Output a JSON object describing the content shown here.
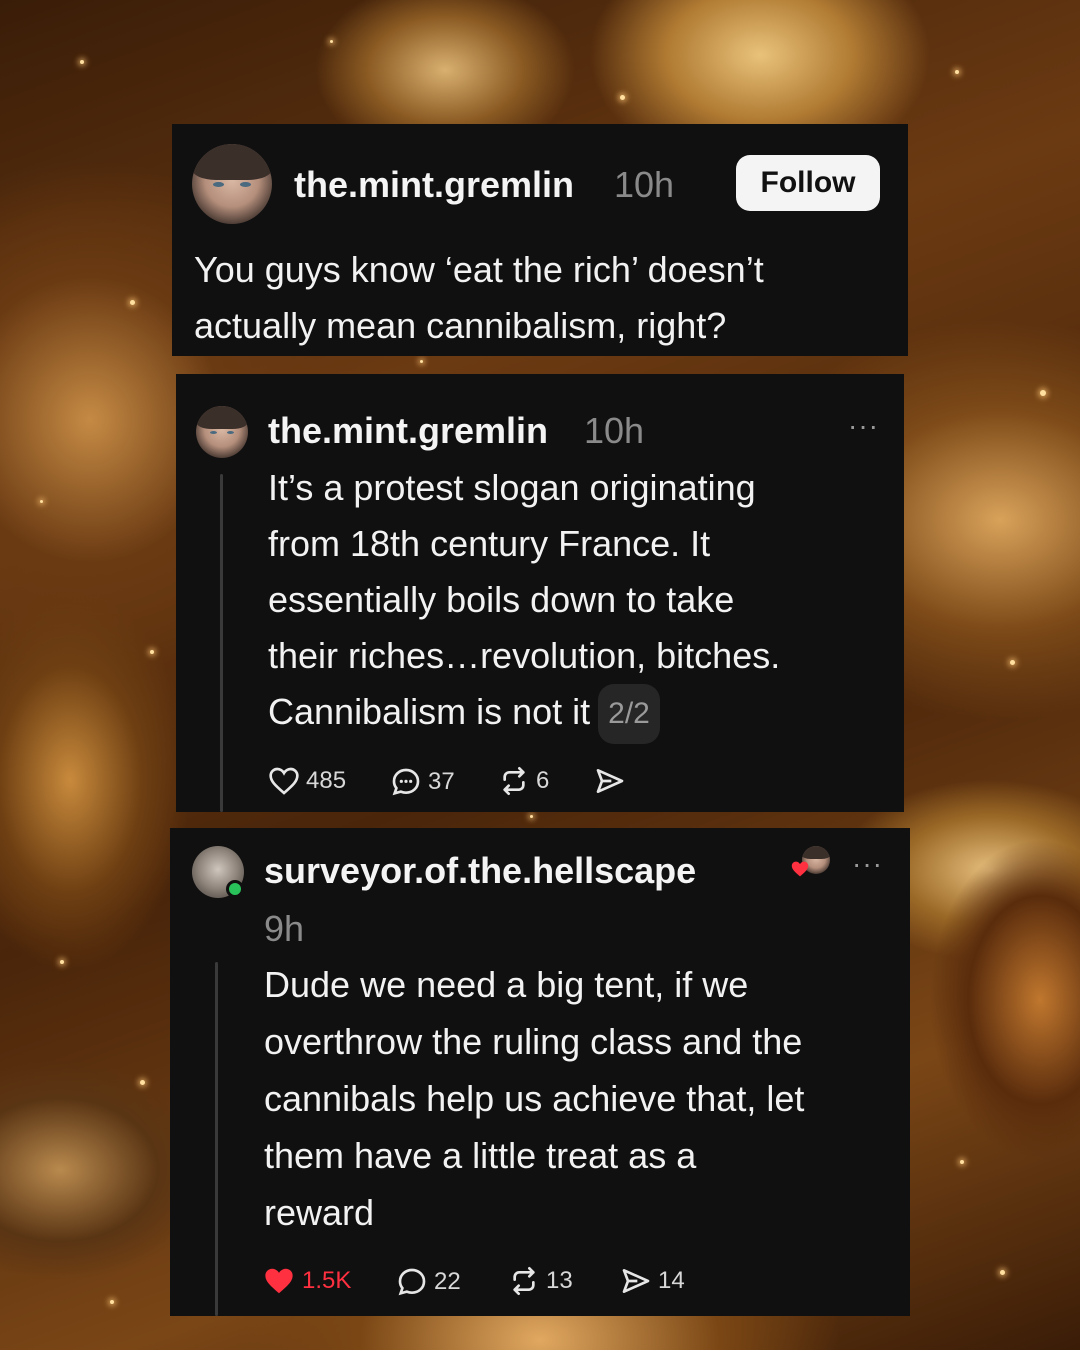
{
  "post": {
    "author": "the.mint.gremlin",
    "time": "10h",
    "follow_label": "Follow",
    "text": "You guys know ‘eat the rich’ doesn’t\nactually mean cannibalism, right?"
  },
  "reply1": {
    "author": "the.mint.gremlin",
    "time": "10h",
    "text": "It’s a protest slogan originating\nfrom 18th century France. It\nessentially boils down to take\ntheir riches…revolution, bitches.\nCannibalism is not it",
    "thread_badge": "2/2",
    "more_label": "···",
    "actions": {
      "likes": "485",
      "replies": "37",
      "reposts": "6"
    }
  },
  "reply2": {
    "author": "surveyor.of.the.hellscape",
    "time": "9h",
    "text": "Dude we need a big tent, if we\noverthrow the ruling class and the\ncannibals help us achieve that, let\nthem have a little treat as a\nreward",
    "more_label": "···",
    "actions": {
      "likes": "1.5K",
      "replies": "22",
      "reposts": "13",
      "shares": "14"
    }
  },
  "colors": {
    "card_bg": "#101010",
    "like_active": "#ff3040",
    "muted": "#8a8a8a"
  },
  "icons": [
    "heart-icon",
    "comment-icon",
    "repost-icon",
    "share-icon",
    "more-icon"
  ]
}
